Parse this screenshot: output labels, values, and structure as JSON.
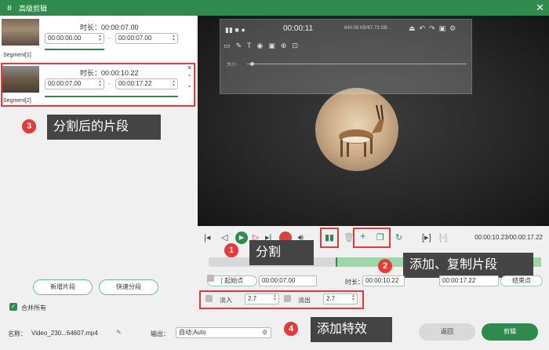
{
  "window": {
    "title": "高级剪辑",
    "logo_icon": "rabbit-logo",
    "close": "✕"
  },
  "segments": [
    {
      "duration_label": "时长：00:00:07.00",
      "start": "00:00:00.00",
      "end": "00:00:07.00",
      "label": "Segment[1]"
    },
    {
      "duration_label": "时长：00:00:10.22",
      "start": "00:00:07.00",
      "end": "00:00:17.22",
      "label": "Segment[2]"
    }
  ],
  "dash": "-",
  "left_buttons": {
    "add_segment": "新增片段",
    "quick_split": "快速分段"
  },
  "merge_all": "合并所有",
  "callouts": {
    "c1": {
      "num": "1",
      "text": "分割"
    },
    "c2": {
      "num": "2",
      "text": "添加、复制片段"
    },
    "c3": {
      "num": "3",
      "text": "分割后的片段"
    },
    "c4": {
      "num": "4",
      "text": "添加特效"
    }
  },
  "recorder_overlay": {
    "time": "00:00:11",
    "info": "640.05 KB/67.73 GB",
    "size_label": "大小:"
  },
  "toolbar": {
    "timecode": "00:00:10.23/00:00:17.22"
  },
  "range": {
    "start_button": "起始点",
    "start_value": "00:00:07.00",
    "duration_label": "时长：",
    "duration_value": "00:00:10.22",
    "end_value": "00:00:17.22",
    "end_button": "结束点"
  },
  "effects": {
    "fade_in_label": "淡入",
    "fade_in_value": "2.7",
    "fade_out_label": "淡出",
    "fade_out_value": "2.7"
  },
  "footer": {
    "name_label": "名称：",
    "name_value": "Video_230...64607.mp4",
    "output_label": "输出：",
    "output_value": "自动;Auto",
    "back": "返回",
    "clip": "剪辑"
  },
  "colors": {
    "accent": "#2f8a4e",
    "highlight": "#e5393a",
    "callout_bg": "#444444"
  }
}
